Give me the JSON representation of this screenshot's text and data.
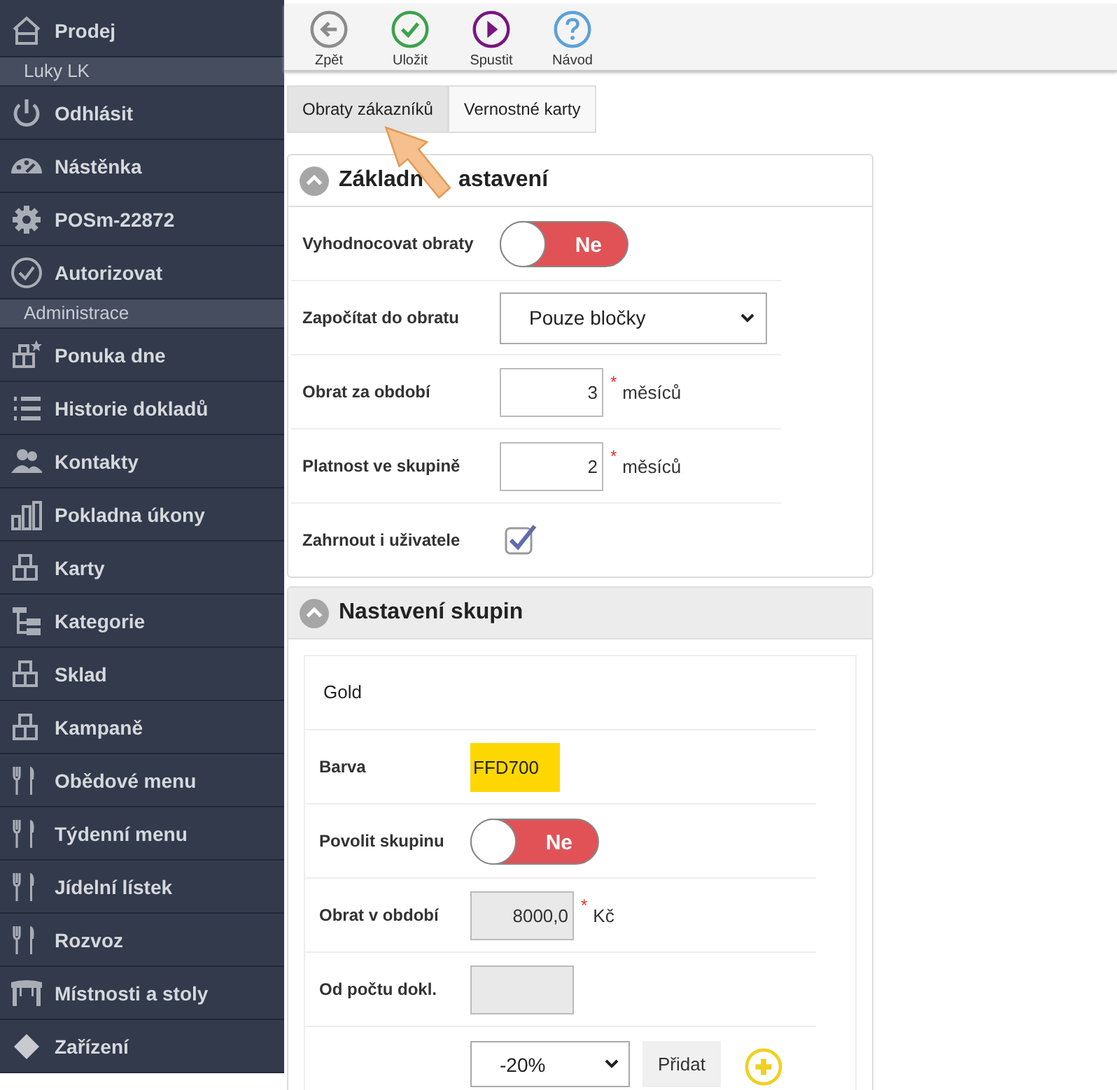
{
  "sidebar": [
    {
      "kind": "home",
      "label": "Prodej"
    },
    {
      "kind": "header",
      "label": "Luky LK"
    },
    {
      "kind": "power",
      "label": "Odhlásit"
    },
    {
      "kind": "gauge",
      "label": "Nástěnka"
    },
    {
      "kind": "gear",
      "label": "POSm-22872"
    },
    {
      "kind": "check",
      "label": "Autorizovat"
    },
    {
      "kind": "header",
      "label": "Administrace"
    },
    {
      "kind": "blocksstar",
      "label": "Ponuka dne"
    },
    {
      "kind": "list",
      "label": "Historie dokladů"
    },
    {
      "kind": "people",
      "label": "Kontakty"
    },
    {
      "kind": "bars",
      "label": "Pokladna úkony"
    },
    {
      "kind": "blocks",
      "label": "Karty"
    },
    {
      "kind": "tree",
      "label": "Kategorie"
    },
    {
      "kind": "blocks",
      "label": "Sklad"
    },
    {
      "kind": "blocks",
      "label": "Kampaně"
    },
    {
      "kind": "cutlery",
      "label": "Obědové menu"
    },
    {
      "kind": "cutlery",
      "label": "Týdenní menu"
    },
    {
      "kind": "cutlery",
      "label": "Jídelní lístek"
    },
    {
      "kind": "cutlery",
      "label": "Rozvoz"
    },
    {
      "kind": "table",
      "label": "Místnosti a stoly"
    },
    {
      "kind": "diamond",
      "label": "Zařízení"
    }
  ],
  "toolbar": [
    {
      "kind": "back",
      "label": "Zpět"
    },
    {
      "kind": "save",
      "label": "Uložit"
    },
    {
      "kind": "run",
      "label": "Spustit"
    },
    {
      "kind": "help",
      "label": "Návod"
    }
  ],
  "tabs": [
    {
      "label": "Obraty zákazníků",
      "selected": true
    },
    {
      "label": "Vernostné karty",
      "selected": false
    }
  ],
  "basic": {
    "title_before": "Základn",
    "title_after": "astavení",
    "rows": [
      {
        "kind": "toggle",
        "label": "Vyhodnocovat obraty",
        "on": false,
        "text": "Ne"
      },
      {
        "kind": "select",
        "label": "Započítat do obratu",
        "value": "Pouze bločky"
      },
      {
        "kind": "number",
        "label": "Obrat za období",
        "value": "3",
        "mark": "*",
        "unit": "měsíců",
        "disabled": false
      },
      {
        "kind": "number",
        "label": "Platnost ve skupině",
        "value": "2",
        "mark": "*",
        "unit": "měsíců",
        "disabled": false
      },
      {
        "kind": "checkbox",
        "label": "Zahrnout i uživatele",
        "checked": true
      }
    ]
  },
  "groups": {
    "title": "Nastavení skupin",
    "name": "Gold",
    "rows": [
      {
        "kind": "color",
        "label": "Barva",
        "value": "FFD700",
        "color": "#ffd700"
      },
      {
        "kind": "toggle",
        "label": "Povolit skupinu",
        "on": false,
        "text": "Ne"
      },
      {
        "kind": "number",
        "label": "Obrat v období",
        "value": "8000,0",
        "mark": "*",
        "unit": "Kč",
        "disabled": true
      },
      {
        "kind": "number",
        "label": "Od počtu dokl.",
        "value": "",
        "disabled": true
      },
      {
        "kind": "campaign",
        "value": "-20%",
        "button": "Přidat"
      }
    ]
  }
}
